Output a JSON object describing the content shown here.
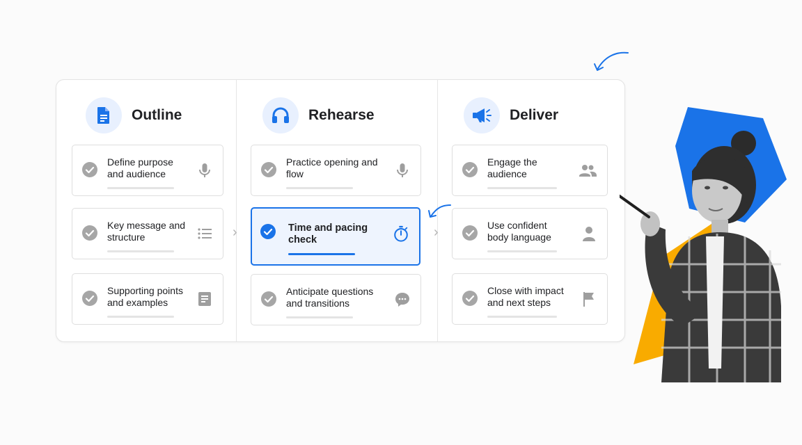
{
  "columns": [
    {
      "title": "Outline",
      "icon": "document-icon",
      "items": [
        {
          "label": "Define purpose and audience",
          "icon": "microphone-icon",
          "done": true
        },
        {
          "label": "Key message and structure",
          "icon": "list-icon",
          "done": true
        },
        {
          "label": "Supporting points and examples",
          "icon": "notes-icon",
          "done": true
        }
      ]
    },
    {
      "title": "Rehearse",
      "icon": "headphones-icon",
      "items": [
        {
          "label": "Practice opening and flow",
          "icon": "microphone-icon",
          "done": true
        },
        {
          "label": "Time and pacing check",
          "icon": "timer-icon",
          "done": true,
          "active": true
        },
        {
          "label": "Anticipate questions and transitions",
          "icon": "chat-bubble-icon",
          "done": true
        }
      ]
    },
    {
      "title": "Deliver",
      "icon": "megaphone-icon",
      "items": [
        {
          "label": "Engage the audience",
          "icon": "people-icon",
          "done": true
        },
        {
          "label": "Use confident body language",
          "icon": "person-icon",
          "done": true
        },
        {
          "label": "Close with impact and next steps",
          "icon": "flag-icon",
          "done": true
        }
      ]
    }
  ],
  "colors": {
    "accent": "#1a73e8",
    "accent_light": "#e8f0fe",
    "check_gray": "#a6a6a6",
    "shape_blue": "#1a73e8",
    "shape_yellow": "#f9ab00"
  }
}
